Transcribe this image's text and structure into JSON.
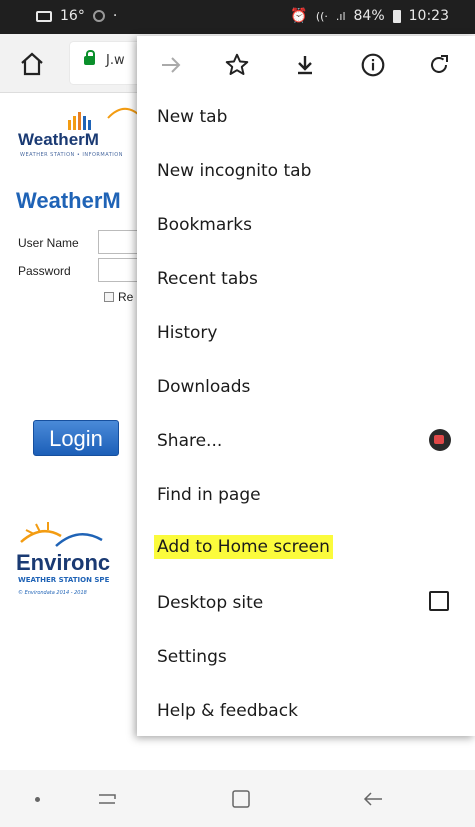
{
  "status_bar": {
    "temperature": "16°",
    "battery": "84%",
    "time": "10:23"
  },
  "toolbar": {
    "url_text": "J.w"
  },
  "page": {
    "logo_text": "WeatherM",
    "logo_subtitle": "WEATHER STATION • INFORMATION",
    "heading": "WeatherM",
    "user_name_label": "User Name",
    "password_label": "Password",
    "remember_label": "Re",
    "login_label": "Login",
    "footer_logo_text": "Environc",
    "footer_logo_subtitle": "WEATHER STATION SPE",
    "copyright": "© Environdata 2014 - 2018"
  },
  "menu": {
    "icons": [
      "forward-icon",
      "bookmark-star-icon",
      "download-icon",
      "info-icon",
      "refresh-icon"
    ],
    "items": [
      {
        "label": "New tab"
      },
      {
        "label": "New incognito tab"
      },
      {
        "label": "Bookmarks"
      },
      {
        "label": "Recent tabs"
      },
      {
        "label": "History"
      },
      {
        "label": "Downloads"
      },
      {
        "label": "Share..."
      },
      {
        "label": "Find in page"
      },
      {
        "label": "Add to Home screen",
        "highlight_color": "#fbfb3c"
      },
      {
        "label": "Desktop site",
        "checked": false
      },
      {
        "label": "Settings"
      },
      {
        "label": "Help & feedback"
      }
    ]
  },
  "colors": {
    "accent_blue": "#1f63b6",
    "highlight": "#fbfb3c",
    "lock_green": "#0a8f2b"
  }
}
